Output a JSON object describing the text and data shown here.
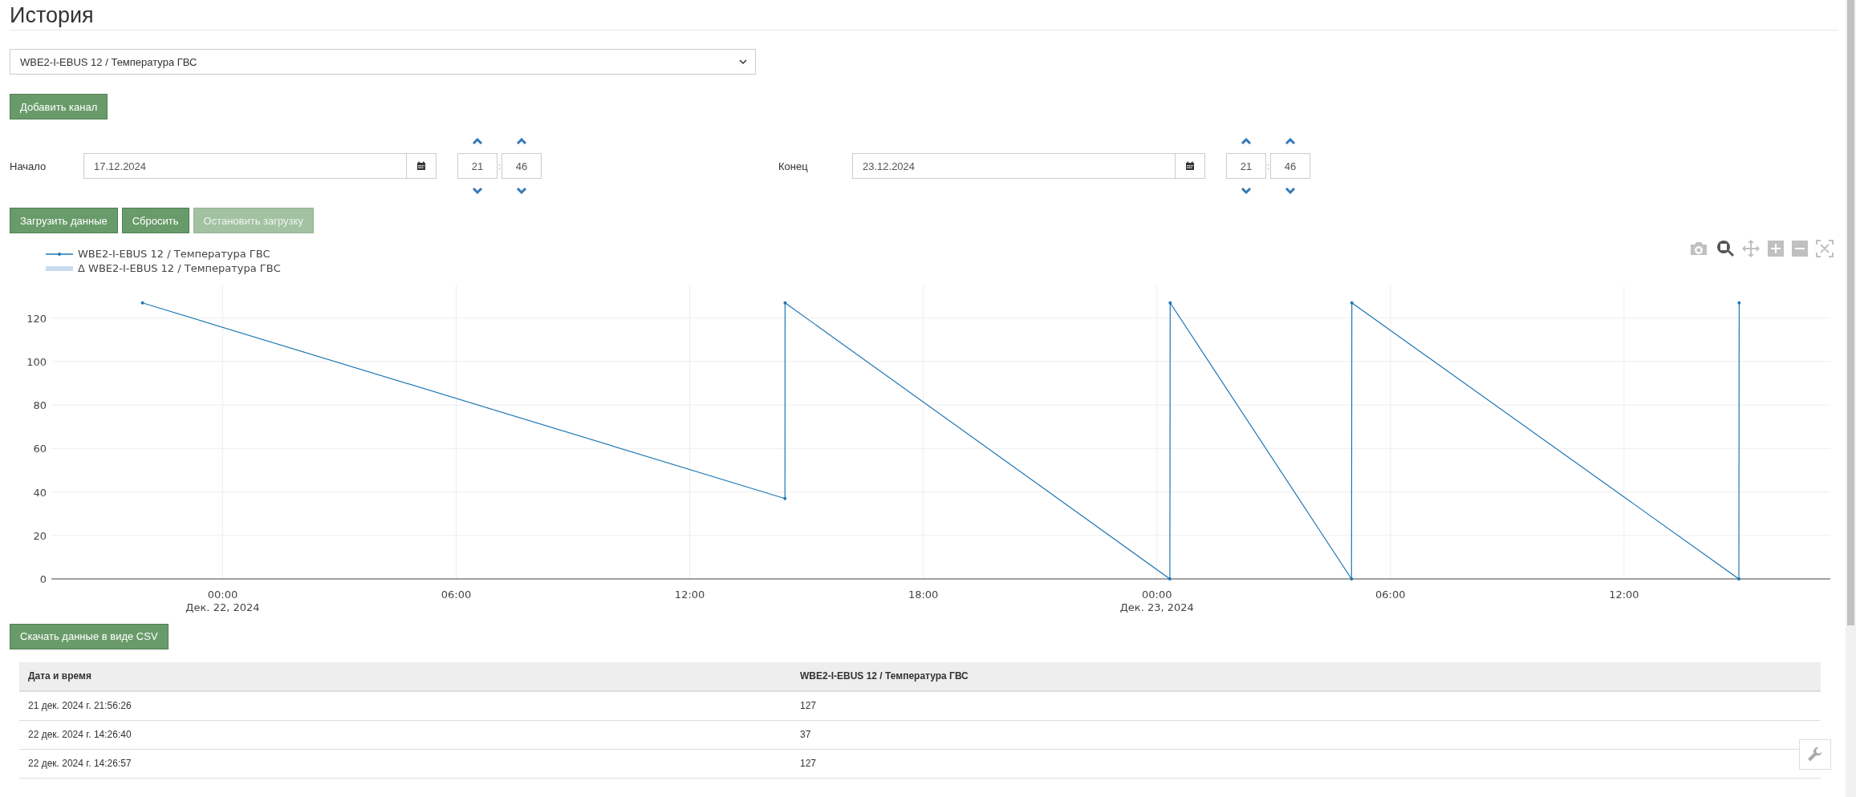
{
  "page": {
    "title": "История"
  },
  "channel_select": {
    "value": "WBE2-I-EBUS 12 / Температура ГВС"
  },
  "add_button": "Добавить канал",
  "range": [
    {
      "label": "Начало",
      "date": "17.12.2024",
      "hour": "21",
      "minute": "46",
      "separator": ":"
    },
    {
      "label": "Конец",
      "date": "23.12.2024",
      "hour": "21",
      "minute": "46",
      "separator": ":"
    }
  ],
  "actions": [
    {
      "label": "Загрузить данные",
      "disabled": false
    },
    {
      "label": "Сбросить",
      "disabled": false
    },
    {
      "label": "Остановить загрузку",
      "disabled": true
    }
  ],
  "chart": {
    "legend": [
      {
        "label": "Δ WBE2-I-EBUS 12 / Температура ГВС",
        "kind": "band"
      }
    ],
    "modebar": [
      {
        "kind": "camera",
        "selected": false
      },
      {
        "kind": "zoom",
        "selected": true
      },
      {
        "kind": "pan",
        "selected": false
      },
      {
        "kind": "zoom-in",
        "selected": false
      },
      {
        "kind": "zoom-out",
        "selected": false
      },
      {
        "kind": "autoscale",
        "selected": false
      }
    ],
    "chart_data": {
      "type": "line",
      "x": [
        "2024-12-21T21:56:26",
        "2024-12-22T14:26:40",
        "2024-12-22T14:26:57",
        "2024-12-23T00:20:00",
        "2024-12-23T00:20:30",
        "2024-12-23T05:00:00",
        "2024-12-23T05:00:30",
        "2024-12-23T14:57:00",
        "2024-12-23T14:57:30"
      ],
      "grid": true,
      "series": [
        {
          "name": "WBE2-I-EBUS 12 / Температура ГВС",
          "color": "#1f77b4",
          "values": [
            127,
            37,
            127,
            0,
            127,
            0,
            127,
            0,
            127
          ]
        }
      ],
      "xlim": [
        "2024-12-21T19:36:00",
        "2024-12-23T17:18:00"
      ],
      "ylim": [
        0,
        135
      ],
      "xticks": [
        {
          "value": "2024-12-22T00:00:00",
          "label": "00:00\nДек. 22, 2024"
        },
        {
          "value": "2024-12-22T06:00:00",
          "label": "06:00"
        },
        {
          "value": "2024-12-22T12:00:00",
          "label": "12:00"
        },
        {
          "value": "2024-12-22T18:00:00",
          "label": "18:00"
        },
        {
          "value": "2024-12-23T00:00:00",
          "label": "00:00\nДек. 23, 2024"
        },
        {
          "value": "2024-12-23T06:00:00",
          "label": "06:00"
        },
        {
          "value": "2024-12-23T12:00:00",
          "label": "12:00"
        }
      ],
      "yticks": [
        0,
        20,
        40,
        60,
        80,
        100,
        120
      ]
    }
  },
  "csv_button": "Скачать данные в виде CSV",
  "table": {
    "columns": [
      "Дата и время",
      "WBE2-I-EBUS 12 / Температура ГВС"
    ],
    "rows": [
      [
        "21 дек. 2024 г. 21:56:26",
        "127"
      ],
      [
        "22 дек. 2024 г. 14:26:40",
        "37"
      ],
      [
        "22 дек. 2024 г. 14:26:57",
        "127"
      ]
    ]
  }
}
